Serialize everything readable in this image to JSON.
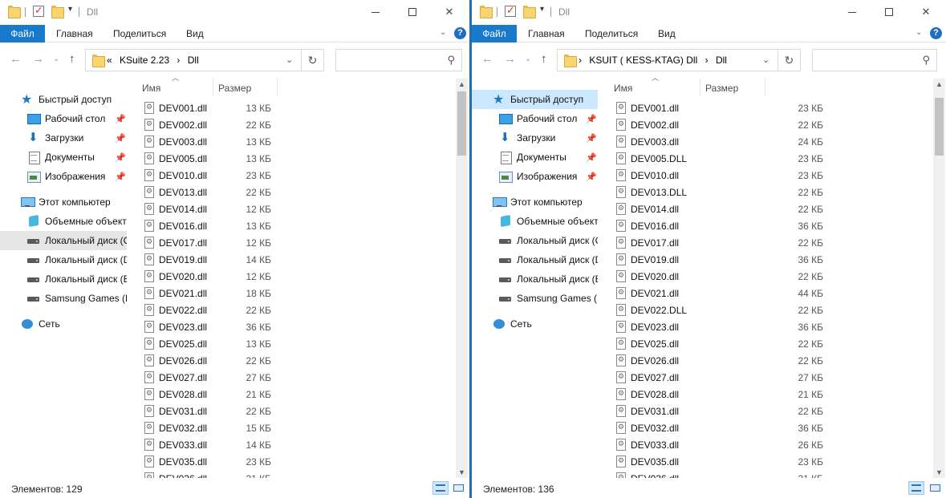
{
  "left": {
    "title": "Dll",
    "ribbon": {
      "file": "Файл",
      "home": "Главная",
      "share": "Поделиться",
      "view": "Вид"
    },
    "address": {
      "overflow": "«",
      "crumb1": "KSuite 2.23",
      "sep": "›",
      "crumb2": "Dll"
    },
    "columns": {
      "name": "Имя",
      "size": "Размер"
    },
    "nav": [
      {
        "label": "Быстрый доступ",
        "icon": "star-icon"
      },
      {
        "label": "Рабочий стол",
        "icon": "desktop-icon",
        "pinned": true
      },
      {
        "label": "Загрузки",
        "icon": "downloads-icon",
        "pinned": true
      },
      {
        "label": "Документы",
        "icon": "documents-icon",
        "pinned": true
      },
      {
        "label": "Изображения",
        "icon": "pictures-icon",
        "pinned": true
      },
      {
        "label": "Этот компьютер",
        "icon": "computer-icon"
      },
      {
        "label": "Объемные объекты",
        "icon": "3d-objects-icon"
      },
      {
        "label": "Локальный диск (C",
        "icon": "system-disk-icon"
      },
      {
        "label": "Локальный диск (D",
        "icon": "disk-icon"
      },
      {
        "label": "Локальный диск (E",
        "icon": "disk-icon"
      },
      {
        "label": "Samsung Games (F:",
        "icon": "disk-icon"
      },
      {
        "label": "Сеть",
        "icon": "network-icon"
      }
    ],
    "files": [
      {
        "name": "DEV001.dll",
        "size": "13 КБ"
      },
      {
        "name": "DEV002.dll",
        "size": "22 КБ"
      },
      {
        "name": "DEV003.dll",
        "size": "13 КБ"
      },
      {
        "name": "DEV005.dll",
        "size": "13 КБ"
      },
      {
        "name": "DEV010.dll",
        "size": "23 КБ"
      },
      {
        "name": "DEV013.dll",
        "size": "22 КБ"
      },
      {
        "name": "DEV014.dll",
        "size": "12 КБ"
      },
      {
        "name": "DEV016.dll",
        "size": "13 КБ"
      },
      {
        "name": "DEV017.dll",
        "size": "12 КБ"
      },
      {
        "name": "DEV019.dll",
        "size": "14 КБ"
      },
      {
        "name": "DEV020.dll",
        "size": "12 КБ"
      },
      {
        "name": "DEV021.dll",
        "size": "18 КБ"
      },
      {
        "name": "DEV022.dll",
        "size": "22 КБ"
      },
      {
        "name": "DEV023.dll",
        "size": "36 КБ"
      },
      {
        "name": "DEV025.dll",
        "size": "13 КБ"
      },
      {
        "name": "DEV026.dll",
        "size": "22 КБ"
      },
      {
        "name": "DEV027.dll",
        "size": "27 КБ"
      },
      {
        "name": "DEV028.dll",
        "size": "21 КБ"
      },
      {
        "name": "DEV031.dll",
        "size": "22 КБ"
      },
      {
        "name": "DEV032.dll",
        "size": "15 КБ"
      },
      {
        "name": "DEV033.dll",
        "size": "14 КБ"
      },
      {
        "name": "DEV035.dll",
        "size": "23 КБ"
      },
      {
        "name": "DEV036.dll",
        "size": "21 КБ"
      }
    ],
    "status": "Элементов: 129"
  },
  "right": {
    "title": "Dll",
    "ribbon": {
      "file": "Файл",
      "home": "Главная",
      "share": "Поделиться",
      "view": "Вид"
    },
    "address": {
      "sep0": "›",
      "crumb1": "KSUIT ( KESS-KTAG) Dll",
      "sep": "›",
      "crumb2": "Dll"
    },
    "columns": {
      "name": "Имя",
      "size": "Размер"
    },
    "nav": [
      {
        "label": "Быстрый доступ",
        "icon": "star-icon"
      },
      {
        "label": "Рабочий стол",
        "icon": "desktop-icon",
        "pinned": true
      },
      {
        "label": "Загрузки",
        "icon": "downloads-icon",
        "pinned": true
      },
      {
        "label": "Документы",
        "icon": "documents-icon",
        "pinned": true
      },
      {
        "label": "Изображения",
        "icon": "pictures-icon",
        "pinned": true
      },
      {
        "label": "Этот компьютер",
        "icon": "computer-icon"
      },
      {
        "label": "Объемные объекты",
        "icon": "3d-objects-icon"
      },
      {
        "label": "Локальный диск (C",
        "icon": "system-disk-icon"
      },
      {
        "label": "Локальный диск (D",
        "icon": "disk-icon"
      },
      {
        "label": "Локальный диск (E",
        "icon": "disk-icon"
      },
      {
        "label": "Samsung Games (F:",
        "icon": "disk-icon"
      },
      {
        "label": "Сеть",
        "icon": "network-icon"
      }
    ],
    "files": [
      {
        "name": "DEV001.dll",
        "size": "23 КБ"
      },
      {
        "name": "DEV002.dll",
        "size": "22 КБ"
      },
      {
        "name": "DEV003.dll",
        "size": "24 КБ"
      },
      {
        "name": "DEV005.DLL",
        "size": "23 КБ"
      },
      {
        "name": "DEV010.dll",
        "size": "23 КБ"
      },
      {
        "name": "DEV013.DLL",
        "size": "22 КБ"
      },
      {
        "name": "DEV014.dll",
        "size": "22 КБ"
      },
      {
        "name": "DEV016.dll",
        "size": "36 КБ"
      },
      {
        "name": "DEV017.dll",
        "size": "22 КБ"
      },
      {
        "name": "DEV019.dll",
        "size": "36 КБ"
      },
      {
        "name": "DEV020.dll",
        "size": "22 КБ"
      },
      {
        "name": "DEV021.dll",
        "size": "44 КБ"
      },
      {
        "name": "DEV022.DLL",
        "size": "22 КБ"
      },
      {
        "name": "DEV023.dll",
        "size": "36 КБ"
      },
      {
        "name": "DEV025.dll",
        "size": "22 КБ"
      },
      {
        "name": "DEV026.dll",
        "size": "22 КБ"
      },
      {
        "name": "DEV027.dll",
        "size": "27 КБ"
      },
      {
        "name": "DEV028.dll",
        "size": "21 КБ"
      },
      {
        "name": "DEV031.dll",
        "size": "22 КБ"
      },
      {
        "name": "DEV032.dll",
        "size": "36 КБ"
      },
      {
        "name": "DEV033.dll",
        "size": "26 КБ"
      },
      {
        "name": "DEV035.dll",
        "size": "23 КБ"
      },
      {
        "name": "DEV036.dll",
        "size": "21 КБ"
      }
    ],
    "status": "Элементов: 136"
  },
  "colors": {
    "accent": "#1979ca",
    "selection": "#cce8ff",
    "divider": "#1f6fb3"
  }
}
